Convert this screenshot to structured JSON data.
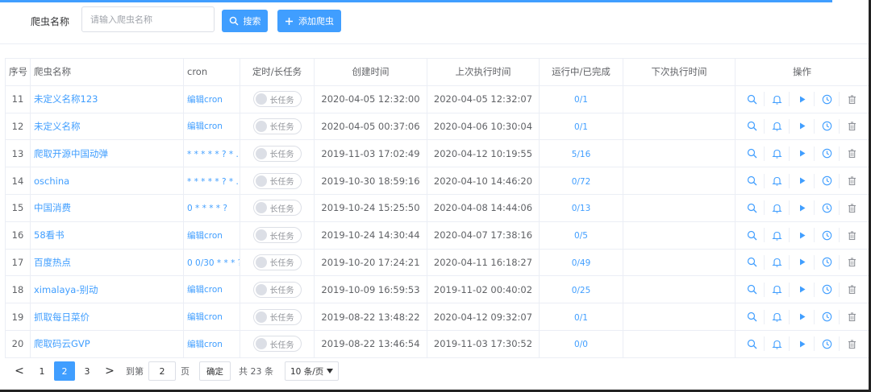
{
  "filter": {
    "label": "爬虫名称",
    "placeholder": "请输入爬虫名称",
    "search_label": "搜索",
    "add_label": "添加爬虫"
  },
  "table": {
    "headers": {
      "index": "序号",
      "name": "爬虫名称",
      "cron": "cron",
      "task": "定时/长任务",
      "created": "创建时间",
      "last_run": "上次执行时间",
      "progress": "运行中/已完成",
      "next_run": "下次执行时间",
      "ops": "操作"
    },
    "toggle_label": "长任务",
    "rows": [
      {
        "index": "11",
        "name": "未定义名称123",
        "cron": "编辑cron",
        "created": "2020-04-05 12:32:00",
        "last_run": "2020-04-05 12:32:07",
        "progress": "0/1",
        "next_run": ""
      },
      {
        "index": "12",
        "name": "未定义名称",
        "cron": "编辑cron",
        "created": "2020-04-05 00:37:06",
        "last_run": "2020-04-06 10:30:04",
        "progress": "0/1",
        "next_run": ""
      },
      {
        "index": "13",
        "name": "爬取开源中国动弹",
        "cron": "* * * * * ? * …",
        "created": "2019-11-03 17:02:49",
        "last_run": "2020-04-12 10:19:55",
        "progress": "5/16",
        "next_run": ""
      },
      {
        "index": "14",
        "name": "oschina",
        "cron": "* * * * * ? * …",
        "created": "2019-10-30 18:59:16",
        "last_run": "2020-04-10 14:46:20",
        "progress": "0/72",
        "next_run": ""
      },
      {
        "index": "15",
        "name": "中国消费",
        "cron": "0 * * * * ?",
        "created": "2019-10-24 15:25:50",
        "last_run": "2020-04-08 14:44:06",
        "progress": "0/13",
        "next_run": ""
      },
      {
        "index": "16",
        "name": "58看书",
        "cron": "编辑cron",
        "created": "2019-10-24 14:30:44",
        "last_run": "2020-04-07 17:38:16",
        "progress": "0/5",
        "next_run": ""
      },
      {
        "index": "17",
        "name": "百度热点",
        "cron": "0 0/30 * * * ? …",
        "created": "2019-10-20 17:24:21",
        "last_run": "2020-04-11 16:18:27",
        "progress": "0/49",
        "next_run": ""
      },
      {
        "index": "18",
        "name": "ximalaya-别动",
        "cron": "编辑cron",
        "created": "2019-10-09 16:59:53",
        "last_run": "2019-11-02 00:40:02",
        "progress": "0/25",
        "next_run": ""
      },
      {
        "index": "19",
        "name": "抓取每日菜价",
        "cron": "编辑cron",
        "created": "2019-08-22 13:48:22",
        "last_run": "2020-04-12 09:32:07",
        "progress": "0/1",
        "next_run": ""
      },
      {
        "index": "20",
        "name": "爬取码云GVP",
        "cron": "编辑cron",
        "created": "2019-08-22 13:46:54",
        "last_run": "2019-11-03 17:30:52",
        "progress": "0/0",
        "next_run": ""
      }
    ],
    "row_icons": [
      "search-icon",
      "bell-icon",
      "play-icon",
      "clock-icon",
      "trash-icon"
    ]
  },
  "pagination": {
    "prev": "<",
    "next": ">",
    "pages": [
      "1",
      "2",
      "3"
    ],
    "current_page": "2",
    "goto_label": "到第",
    "goto_value": "2",
    "page_unit": "页",
    "confirm_label": "确定",
    "total_label": "共 23 条",
    "page_size_label": "10 条/页"
  },
  "colors": {
    "accent": "#409eff",
    "border": "#ebeef5",
    "text": "#606266"
  }
}
